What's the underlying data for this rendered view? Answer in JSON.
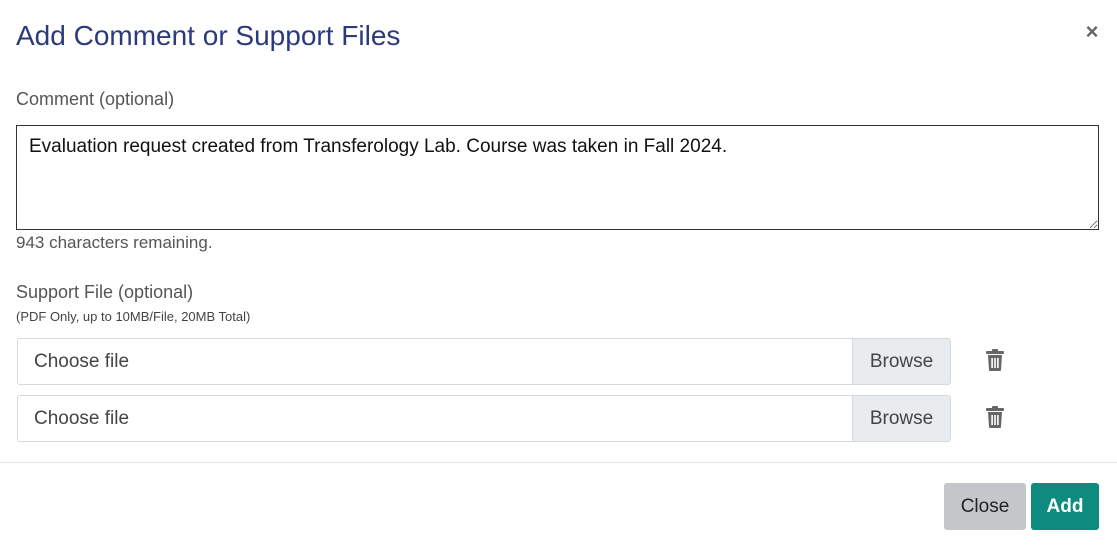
{
  "modal": {
    "title": "Add Comment or Support Files",
    "close_symbol": "×"
  },
  "comment": {
    "label": "Comment (optional)",
    "value": "Evaluation request created from Transferology Lab. Course was taken in Fall 2024.",
    "remaining": "943 characters remaining."
  },
  "support": {
    "label": "Support File (optional)",
    "hint": "(PDF Only, up to 10MB/File, 20MB Total)",
    "files": [
      {
        "placeholder": "Choose file",
        "browse_label": "Browse",
        "delete_icon": "trash-icon"
      },
      {
        "placeholder": "Choose file",
        "browse_label": "Browse",
        "delete_icon": "trash-icon"
      }
    ]
  },
  "footer": {
    "close_label": "Close",
    "add_label": "Add"
  },
  "colors": {
    "title": "#2a3a7c",
    "add_button": "#0e8a7e",
    "close_button": "#c3c7c9",
    "icon": "#666666"
  }
}
